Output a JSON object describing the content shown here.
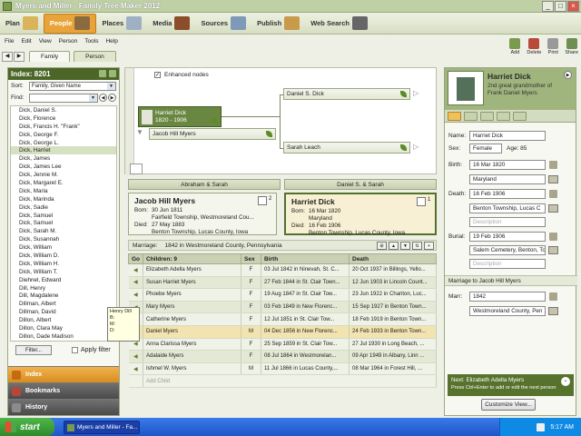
{
  "window": {
    "title": "Myers and Miller - Family Tree Maker 2012"
  },
  "nav": {
    "items": [
      "Plan",
      "People",
      "Places",
      "Media",
      "Sources",
      "Publish",
      "Web Search"
    ]
  },
  "menu": {
    "items": [
      "File",
      "Edit",
      "View",
      "Person",
      "Tools",
      "Help"
    ]
  },
  "toolbar": {
    "buttons": [
      "Add",
      "Delete",
      "Print",
      "Share"
    ]
  },
  "tabs": {
    "arrows": [
      "◀",
      "▶"
    ],
    "items": [
      "Family",
      "Person"
    ]
  },
  "index": {
    "title": "Index: 8201",
    "sort_label": "Sort:",
    "sort_value": "Family, Given Name",
    "find_label": "Find:",
    "find_value": "",
    "names": [
      "Dick, Daniel S.",
      "Dick, Florence",
      "Dick, Francis H. \"Frank\"",
      "Dick, George F.",
      "Dick, George L.",
      "Dick, Harriet",
      "Dick, James",
      "Dick, James Lee",
      "Dick, Jennie M.",
      "Dick, Margaret E.",
      "Dick, Maria",
      "Dick, Marinda",
      "Dick, Sadie",
      "Dick, Samuel",
      "Dick, Samuel",
      "Dick, Sarah M.",
      "Dick, Susannah",
      "Dick, William",
      "Dick, William D.",
      "Dick, William H.",
      "Dick, William T.",
      "Diehnel, Edward",
      "Dill, Henry",
      "Dill, Magdalene",
      "Dillman, Albert",
      "Dillman, David",
      "Dillon, Albert",
      "Dillon, Clara May",
      "Dillon, Dade Madison"
    ],
    "filter_label": "Filter...",
    "apply_filter_label": "Apply filter"
  },
  "tooltip": {
    "lines": [
      "Henry Dill",
      "B:",
      "M:",
      "D:"
    ]
  },
  "sidenav": {
    "items": [
      "Index",
      "Bookmarks",
      "History"
    ]
  },
  "tree": {
    "enhanced_label": "Enhanced nodes",
    "root": {
      "name": "Harriet Dick",
      "years": "1820 - 1906"
    },
    "spouse": "Jacob Hill Myers",
    "father": "Daniel S. Dick",
    "mother": "Sarah Leach"
  },
  "family": {
    "parents": [
      "Abraham & Sarah",
      "Daniel S. & Sarah"
    ],
    "husband": {
      "name": "Jacob Hill Myers",
      "born_label": "Born:",
      "born_date": "30 Jun 1811",
      "born_place": "Fairfield Township, Westmoreland Cou...",
      "died_label": "Died:",
      "died_date": "27 May 1883",
      "died_place": "Benton Township, Lucas County, Iowa",
      "count": "2"
    },
    "wife": {
      "name": "Harriet Dick",
      "born_label": "Born:",
      "born_date": "16 Mar 1820",
      "born_place": "Maryland",
      "died_label": "Died:",
      "died_date": "16 Feb 1906",
      "died_place": "Benton Township, Lucas County, Iowa",
      "count": "1"
    },
    "marriage_label": "Marriage:",
    "marriage_value": "1842 in Westmoreland County, Pennsylvania"
  },
  "children": {
    "headers": [
      "Go",
      "Children: 9",
      "Sex",
      "Birth",
      "Death"
    ],
    "rows": [
      {
        "name": "Elizabeth Adella Myers",
        "sex": "F",
        "birth": "03 Jul 1842 in Ninevah, St. C...",
        "death": "20 Oct 1937 in Billings, Yello..."
      },
      {
        "name": "Susan Harriet Myers",
        "sex": "F",
        "birth": "27 Feb 1844 in St. Clair Town...",
        "death": "12 Jun 1903 in Lincoln Count..."
      },
      {
        "name": "Phoebe Myers",
        "sex": "F",
        "birth": "19 Aug 1847 in St. Clair Tow...",
        "death": "23 Jun 1922 in Chariton, Luc..."
      },
      {
        "name": "Mary Myers",
        "sex": "F",
        "birth": "03 Feb 1849 in New Florenc...",
        "death": "15 Sep 1927 in Benton Town..."
      },
      {
        "name": "Catherine Myers",
        "sex": "F",
        "birth": "12 Jul 1851 in St. Clair Tow...",
        "death": "18 Feb 1919 in Benton Town..."
      },
      {
        "name": "Daniel Myers",
        "sex": "M",
        "birth": "04 Dec 1856 in New Florenc...",
        "death": "24 Feb 1933 in Benton Town..."
      },
      {
        "name": "Anna Clarissa Myers",
        "sex": "F",
        "birth": "25 Sep 1859 in St. Clair Tow...",
        "death": "27 Jul 1930 in Long Beach, ..."
      },
      {
        "name": "Adalaide Myers",
        "sex": "F",
        "birth": "08 Jul 1864 in Westmorelan...",
        "death": "09 Apr 1949 in Albany, Linn ..."
      },
      {
        "name": "Ishmel W. Myers",
        "sex": "M",
        "birth": "11 Jul 1866 in Lucas County,...",
        "death": "08 Mar 1964 in Forest Hill, ..."
      }
    ],
    "add_child_label": "Add Child"
  },
  "person": {
    "name": "Harriet Dick",
    "relation": "2nd great grandmother of Frank Daniel Myers",
    "name_label": "Name:",
    "name_value": "Harriet Dick",
    "sex_label": "Sex:",
    "sex_value": "Female",
    "age_label": "Age: 85",
    "birth_label": "Birth:",
    "birth_date": "16 Mar 1820",
    "birth_place": "Maryland",
    "death_label": "Death:",
    "death_date": "16 Feb 1906",
    "death_place": "Benton Township, Lucas C",
    "description_placeholder": "Description",
    "burial_label": "Burial:",
    "burial_date": "19 Feb 1906",
    "burial_place": "Salem Cemetery, Benton, To",
    "marriage_bar": "Marriage to Jacob Hill Myers",
    "marr_label": "Marr:",
    "marr_date": "1842",
    "marr_place": "Westmoreland County, Pen",
    "next_label": "Next:",
    "next_value": "Elizabeth Adella Myers",
    "next_hint": "Press Ctrl+Enter to add or edit the next person",
    "customize_label": "Customize View..."
  },
  "taskbar": {
    "start": "start",
    "app": "Myers and Miller - Fa...",
    "time": "5:17 AM"
  }
}
